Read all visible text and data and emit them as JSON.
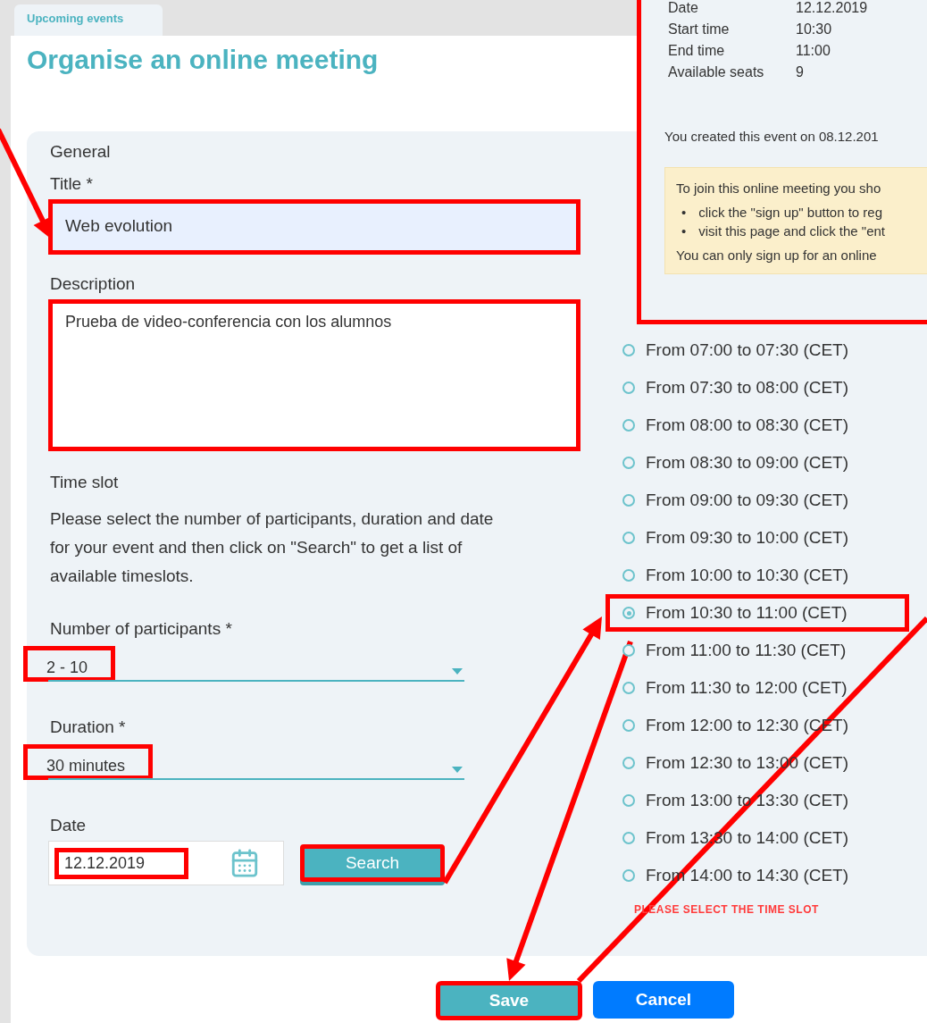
{
  "tab": {
    "label": "Upcoming events"
  },
  "dialog": {
    "title": "Organise an online meeting"
  },
  "event_details": {
    "highlighted": true,
    "rows": [
      {
        "label": "Date",
        "value": "12.12.2019"
      },
      {
        "label": "Start time",
        "value": "10:30"
      },
      {
        "label": "End time",
        "value": "11:00"
      },
      {
        "label": "Available seats",
        "value": "9"
      }
    ],
    "created_note": "You created this event on 08.12.201",
    "notice": {
      "bullet": "•",
      "intro": "To join this online meeting you sho",
      "steps": [
        "click the \"sign up\" button to reg",
        "visit this page and click the \"ent"
      ],
      "footer": "You can only sign up for an online"
    }
  },
  "general": {
    "heading": "General",
    "title_field": {
      "label": "Title *",
      "value": "Web evolution",
      "highlighted": true
    },
    "description_field": {
      "label": "Description",
      "value": "Prueba de video-conferencia con los alumnos",
      "highlighted": true
    }
  },
  "time_slot": {
    "heading": "Time slot",
    "instructions": "Please select the number of participants, duration and date for your event and then click on \"Search\" to get a list of available timeslots.",
    "participants": {
      "label": "Number of participants *",
      "value": "2 - 10",
      "highlighted": true
    },
    "duration": {
      "label": "Duration *",
      "value": "30 minutes",
      "highlighted": true
    },
    "date": {
      "label": "Date",
      "value": "12.12.2019",
      "highlighted": true
    },
    "search_button": {
      "label": "Search",
      "highlighted": true
    }
  },
  "slots": {
    "items": [
      {
        "label": "From 07:00 to 07:30 (CET)",
        "selected": false,
        "highlighted": false
      },
      {
        "label": "From 07:30 to 08:00 (CET)",
        "selected": false,
        "highlighted": false
      },
      {
        "label": "From 08:00 to 08:30 (CET)",
        "selected": false,
        "highlighted": false
      },
      {
        "label": "From 08:30 to 09:00 (CET)",
        "selected": false,
        "highlighted": false
      },
      {
        "label": "From 09:00 to 09:30 (CET)",
        "selected": false,
        "highlighted": false
      },
      {
        "label": "From 09:30 to 10:00 (CET)",
        "selected": false,
        "highlighted": false
      },
      {
        "label": "From 10:00 to 10:30 (CET)",
        "selected": false,
        "highlighted": false
      },
      {
        "label": "From 10:30 to 11:00 (CET)",
        "selected": true,
        "highlighted": true
      },
      {
        "label": "From 11:00 to 11:30 (CET)",
        "selected": false,
        "highlighted": false
      },
      {
        "label": "From 11:30 to 12:00 (CET)",
        "selected": false,
        "highlighted": false
      },
      {
        "label": "From 12:00 to 12:30 (CET)",
        "selected": false,
        "highlighted": false
      },
      {
        "label": "From 12:30 to 13:00 (CET)",
        "selected": false,
        "highlighted": false
      },
      {
        "label": "From 13:00 to 13:30 (CET)",
        "selected": false,
        "highlighted": false
      },
      {
        "label": "From 13:30 to 14:00 (CET)",
        "selected": false,
        "highlighted": false
      },
      {
        "label": "From 14:00 to 14:30 (CET)",
        "selected": false,
        "highlighted": false
      }
    ],
    "error": "PLEASE SELECT THE TIME SLOT"
  },
  "buttons": [
    {
      "label": "Save",
      "kind": "primary",
      "highlighted": true
    },
    {
      "label": "Cancel",
      "kind": "secondary",
      "highlighted": false
    }
  ]
}
